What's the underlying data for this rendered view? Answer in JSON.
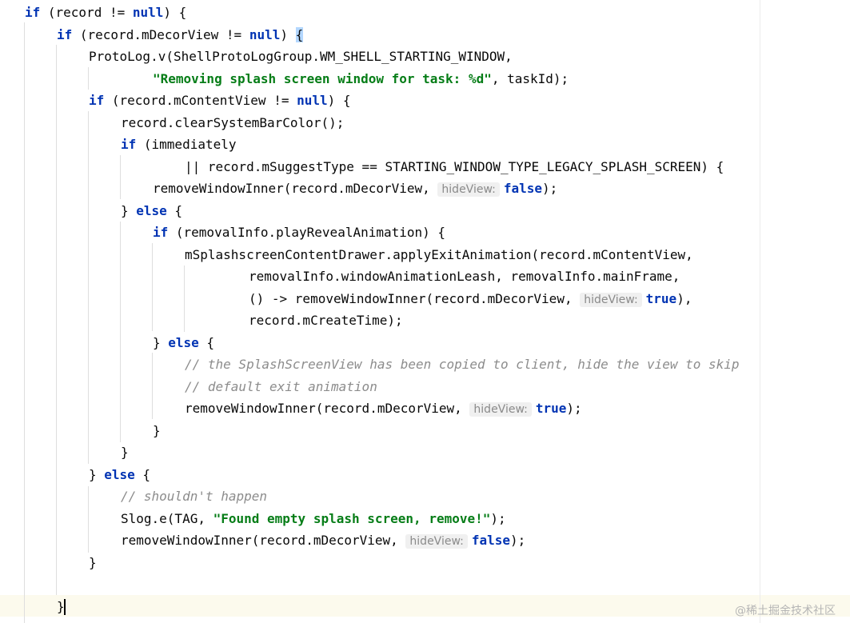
{
  "editor": {
    "lines": [
      [
        [
          "kw",
          "if"
        ],
        [
          "pl",
          " (record != "
        ],
        [
          "kw",
          "null"
        ],
        [
          "pl",
          ") {"
        ]
      ],
      [
        [
          "kw",
          "if"
        ],
        [
          "pl",
          " (record.mDecorView != "
        ],
        [
          "kw",
          "null"
        ],
        [
          "pl",
          ") "
        ],
        [
          "brace",
          "{"
        ]
      ],
      [
        [
          "pl",
          "ProtoLog.v(ShellProtoLogGroup.WM_SHELL_STARTING_WINDOW,"
        ]
      ],
      [
        [
          "str",
          "\"Removing splash screen window for task: %d\""
        ],
        [
          "pl",
          ", taskId);"
        ]
      ],
      [
        [
          "kw",
          "if"
        ],
        [
          "pl",
          " (record.mContentView != "
        ],
        [
          "kw",
          "null"
        ],
        [
          "pl",
          ") {"
        ]
      ],
      [
        [
          "pl",
          "record.clearSystemBarColor();"
        ]
      ],
      [
        [
          "kw",
          "if"
        ],
        [
          "pl",
          " (immediately"
        ]
      ],
      [
        [
          "pl",
          "|| record.mSuggestType == STARTING_WINDOW_TYPE_LEGACY_SPLASH_SCREEN) {"
        ]
      ],
      [
        [
          "pl",
          "removeWindowInner(record.mDecorView, "
        ],
        [
          "hint",
          "hideView:"
        ],
        [
          "kw",
          "false"
        ],
        [
          "pl",
          ");"
        ]
      ],
      [
        [
          "pl",
          "} "
        ],
        [
          "kw",
          "else"
        ],
        [
          "pl",
          " {"
        ]
      ],
      [
        [
          "kw",
          "if"
        ],
        [
          "pl",
          " (removalInfo.playRevealAnimation) {"
        ]
      ],
      [
        [
          "pl",
          "mSplashscreenContentDrawer.applyExitAnimation(record.mContentView,"
        ]
      ],
      [
        [
          "pl",
          "removalInfo.windowAnimationLeash, removalInfo.mainFrame,"
        ]
      ],
      [
        [
          "pl",
          "() -> removeWindowInner(record.mDecorView, "
        ],
        [
          "hint",
          "hideView:"
        ],
        [
          "kw",
          "true"
        ],
        [
          "pl",
          "),"
        ]
      ],
      [
        [
          "pl",
          "record.mCreateTime);"
        ]
      ],
      [
        [
          "pl",
          "} "
        ],
        [
          "kw",
          "else"
        ],
        [
          "pl",
          " {"
        ]
      ],
      [
        [
          "cmt",
          "// the SplashScreenView has been copied to client, hide the view to skip"
        ]
      ],
      [
        [
          "cmt",
          "// default exit animation"
        ]
      ],
      [
        [
          "pl",
          "removeWindowInner(record.mDecorView, "
        ],
        [
          "hint",
          "hideView:"
        ],
        [
          "kw",
          "true"
        ],
        [
          "pl",
          ");"
        ]
      ],
      [
        [
          "pl",
          "}"
        ]
      ],
      [
        [
          "pl",
          "}"
        ]
      ],
      [
        [
          "pl",
          "} "
        ],
        [
          "kw",
          "else"
        ],
        [
          "pl",
          " {"
        ]
      ],
      [
        [
          "cmt",
          "// shouldn't happen"
        ]
      ],
      [
        [
          "pl",
          "Slog.e(TAG, "
        ],
        [
          "str",
          "\"Found empty splash screen, remove!\""
        ],
        [
          "pl",
          ");"
        ]
      ],
      [
        [
          "pl",
          "removeWindowInner(record.mDecorView, "
        ],
        [
          "hint",
          "hideView:"
        ],
        [
          "kw",
          "false"
        ],
        [
          "pl",
          ");"
        ]
      ],
      [
        [
          "pl",
          "}"
        ]
      ],
      [],
      [
        [
          "caret-brace",
          "}"
        ]
      ]
    ]
  },
  "watermark": "@稀土掘金技术社区"
}
